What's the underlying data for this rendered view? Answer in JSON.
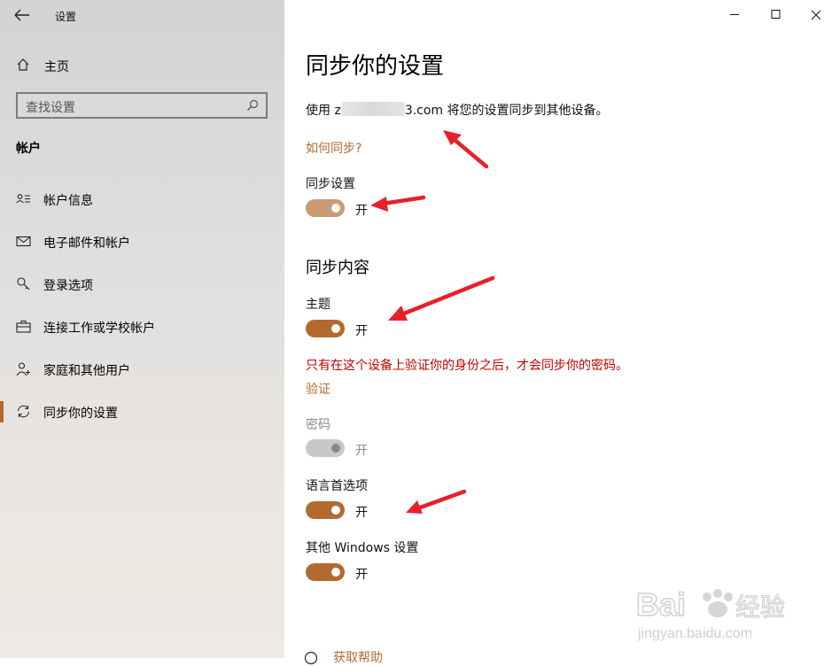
{
  "app": {
    "title": "设置"
  },
  "sidebar": {
    "home_label": "主页",
    "search_placeholder": "查找设置",
    "section_title": "帐户",
    "items": [
      {
        "label": "帐户信息",
        "icon": "account-info-icon"
      },
      {
        "label": "电子邮件和帐户",
        "icon": "mail-icon"
      },
      {
        "label": "登录选项",
        "icon": "key-icon"
      },
      {
        "label": "连接工作或学校帐户",
        "icon": "briefcase-icon"
      },
      {
        "label": "家庭和其他用户",
        "icon": "person-add-icon"
      },
      {
        "label": "同步你的设置",
        "icon": "sync-icon",
        "active": true
      }
    ]
  },
  "main": {
    "title": "同步你的设置",
    "description_prefix": "使用 z",
    "description_suffix": "3.com 将您的设置同步到其他设备。",
    "how_link": "如何同步?",
    "sync_setting": {
      "label": "同步设置",
      "state": "开"
    },
    "sync_content_title": "同步内容",
    "theme": {
      "label": "主题",
      "state": "开"
    },
    "warning": "只有在这个设备上验证你的身份之后，才会同步你的密码。",
    "verify_link": "验证",
    "password": {
      "label": "密码",
      "state": "开"
    },
    "language": {
      "label": "语言首选项",
      "state": "开"
    },
    "other": {
      "label": "其他 Windows 设置",
      "state": "开"
    },
    "help_link": "获取帮助"
  },
  "colors": {
    "accent": "#b36a2e",
    "accent_light": "#c99a74",
    "warning": "#c00000",
    "annotation_arrow": "#e8202a"
  },
  "watermark": {
    "text": "Bai 经验",
    "subtext": "jingyan.baidu.com"
  }
}
